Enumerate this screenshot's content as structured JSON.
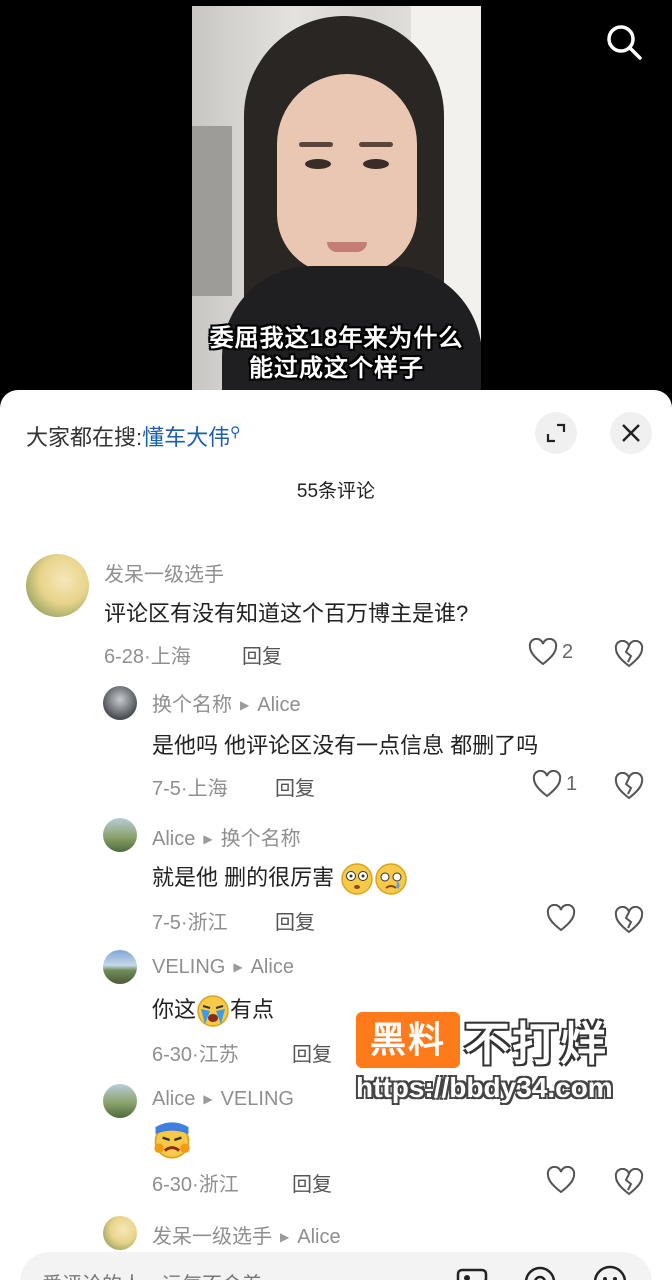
{
  "video": {
    "subtitle_line1": "委屈我这18年来为什么",
    "subtitle_line2": "能过成这个样子"
  },
  "panel": {
    "trend_label": "大家都在搜:",
    "trend_keyword": "懂车大伟",
    "comment_count": "55条评论"
  },
  "comments": [
    {
      "name": "发呆一级选手",
      "text": "评论区有没有知道这个百万博主是谁?",
      "date": "6-28",
      "location": "上海",
      "reply": "回复",
      "likes": "2"
    },
    {
      "name": "换个名称",
      "reply_to": "Alice",
      "text": "是他吗 他评论区没有一点信息 都删了吗",
      "date": "7-5",
      "location": "上海",
      "reply": "回复",
      "likes": "1"
    },
    {
      "name": "Alice",
      "reply_to": "换个名称",
      "text": "就是他 删的很厉害",
      "date": "7-5",
      "location": "浙江",
      "reply": "回复",
      "likes": ""
    },
    {
      "name": "VELING",
      "reply_to": "Alice",
      "text_before": "你这",
      "text_after": "有点",
      "date": "6-30",
      "location": "江苏",
      "reply": "回复",
      "likes": ""
    },
    {
      "name": "Alice",
      "reply_to": "VELING",
      "text": "",
      "date": "6-30",
      "location": "浙江",
      "reply": "回复",
      "likes": ""
    },
    {
      "name": "发呆一级选手",
      "reply_to": "Alice"
    }
  ],
  "watermark": {
    "badge": "黑料",
    "text": "不打烊",
    "url": "https://bbdy34.com"
  },
  "input": {
    "placeholder": "爱评论的人，运气不会差"
  },
  "icons": [
    "search-icon",
    "expand-icon",
    "close-icon",
    "heart-icon",
    "broken-heart-icon",
    "image-icon",
    "at-icon",
    "emoji-icon"
  ]
}
